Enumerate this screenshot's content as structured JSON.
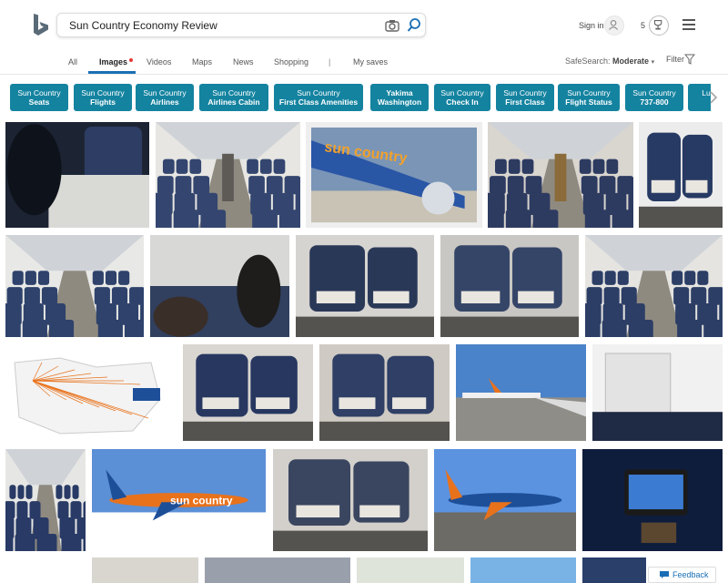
{
  "search": {
    "query": "Sun Country Economy Review"
  },
  "header": {
    "signin_label": "Sign in",
    "rewards_count": "5"
  },
  "nav": {
    "tabs": [
      "All",
      "Images",
      "Videos",
      "Maps",
      "News",
      "Shopping"
    ],
    "separator": "|",
    "my_saves": "My saves",
    "active_tab": "Images"
  },
  "safesearch": {
    "label": "SafeSearch:",
    "value": "Moderate"
  },
  "filter": {
    "label": "Filter"
  },
  "related_chips": [
    {
      "line1": "Sun Country",
      "line2": "Seats",
      "bold_first": false
    },
    {
      "line1": "Sun Country",
      "line2": "Flights",
      "bold_first": false
    },
    {
      "line1": "Sun Country",
      "line2": "Airlines",
      "bold_first": false
    },
    {
      "line1": "Sun Country",
      "line2": "Airlines Cabin",
      "bold_first": false
    },
    {
      "line1": "Sun Country",
      "line2": "First Class Amenities",
      "bold_first": false
    },
    {
      "line1": "Yakima",
      "line2": "Washington",
      "bold_first": true
    },
    {
      "line1": "Sun Country",
      "line2": "Check In",
      "bold_first": false
    },
    {
      "line1": "Sun Country",
      "line2": "First Class",
      "bold_first": false
    },
    {
      "line1": "Sun Country",
      "line2": "Flight Status",
      "bold_first": false
    },
    {
      "line1": "Sun Country",
      "line2": "737-800",
      "bold_first": false
    },
    {
      "line1": "Lu",
      "line2": "",
      "bold_first": false
    }
  ],
  "image_tiles": [
    {
      "subject": "seat-closeup-dark"
    },
    {
      "subject": "cabin-aisle-blue"
    },
    {
      "subject": "plane-wing-window"
    },
    {
      "subject": "cabin-aisle-passengers"
    },
    {
      "subject": "first-class-seat"
    },
    {
      "subject": "cabin-passengers"
    },
    {
      "subject": "passenger-aisle"
    },
    {
      "subject": "leather-seats"
    },
    {
      "subject": "seats-window"
    },
    {
      "subject": "cabin-rows"
    },
    {
      "subject": "route-map"
    },
    {
      "subject": "first-class-window"
    },
    {
      "subject": "seats-row"
    },
    {
      "subject": "tarmac-planes"
    },
    {
      "subject": "seatback-table"
    },
    {
      "subject": "cabin-seats-blue"
    },
    {
      "subject": "sun-country-plane-flight"
    },
    {
      "subject": "first-class-recline"
    },
    {
      "subject": "plane-on-tarmac"
    },
    {
      "subject": "seatback-screen"
    }
  ],
  "brand_text": {
    "plane_livery": "sun country"
  },
  "feedback": {
    "label": "Feedback"
  },
  "colors": {
    "chip_bg": "#1483a0",
    "accent": "#1a6fb4",
    "brand_orange": "#e8721c",
    "brand_blue": "#1d4f99"
  }
}
